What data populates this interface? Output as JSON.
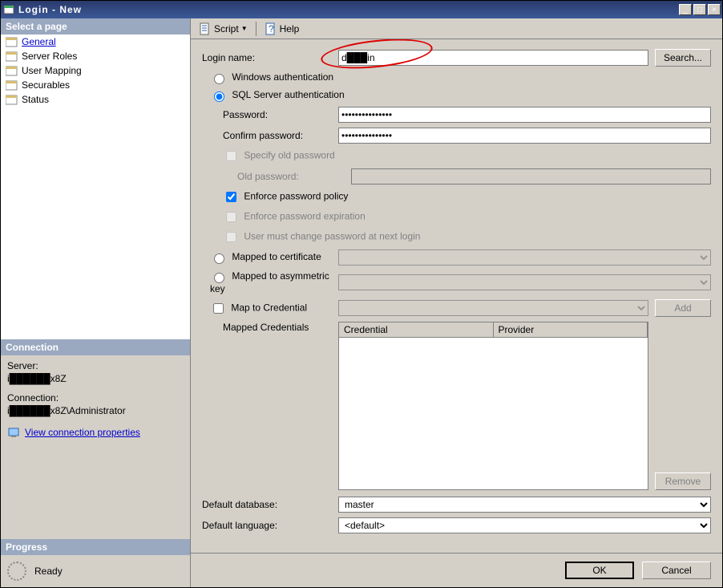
{
  "window": {
    "title": "Login - New"
  },
  "pages": {
    "header": "Select a page",
    "items": [
      "General",
      "Server Roles",
      "User Mapping",
      "Securables",
      "Status"
    ],
    "selected": 0
  },
  "connection": {
    "header": "Connection",
    "server_label": "Server:",
    "server_value": "i██████x8Z",
    "conn_label": "Connection:",
    "conn_value": "i██████x8Z\\Administrator",
    "view_link": "View connection properties"
  },
  "progress": {
    "header": "Progress",
    "status": "Ready"
  },
  "toolbar": {
    "script": "Script",
    "help": "Help"
  },
  "form": {
    "login_name_label": "Login name:",
    "login_name_value": "d███in",
    "search": "Search...",
    "win_auth": "Windows authentication",
    "sql_auth": "SQL Server authentication",
    "auth_mode": "sql",
    "password_label": "Password:",
    "password_value": "●●●●●●●●●●●●●●●",
    "confirm_label": "Confirm password:",
    "confirm_value": "●●●●●●●●●●●●●●●",
    "specify_old": "Specify old password",
    "old_pwd_label": "Old password:",
    "enforce_policy": "Enforce password policy",
    "enforce_policy_checked": true,
    "enforce_exp": "Enforce password expiration",
    "must_change": "User must change password at next login",
    "mapped_cert": "Mapped to certificate",
    "mapped_asym": "Mapped to asymmetric key",
    "map_cred": "Map to Credential",
    "add": "Add",
    "mapped_creds_label": "Mapped Credentials",
    "col_credential": "Credential",
    "col_provider": "Provider",
    "remove": "Remove",
    "def_db_label": "Default database:",
    "def_db_value": "master",
    "def_lang_label": "Default language:",
    "def_lang_value": "<default>"
  },
  "footer": {
    "ok": "OK",
    "cancel": "Cancel"
  }
}
